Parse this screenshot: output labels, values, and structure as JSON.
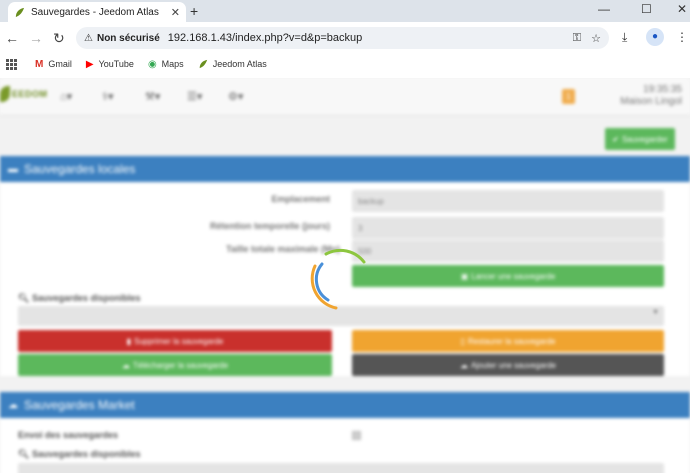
{
  "browser": {
    "tab_title": "Sauvegardes - Jeedom Atlas",
    "tab_close": "✕",
    "new_tab": "+",
    "window_controls": [
      "—",
      "☐",
      "✕"
    ],
    "security_label": "Non sécurisé",
    "url": "192.168.1.43/index.php?v=d&p=backup",
    "bookmarks": [
      {
        "label": "Gmail",
        "icon": "gmail-icon"
      },
      {
        "label": "YouTube",
        "icon": "youtube-icon"
      },
      {
        "label": "Maps",
        "icon": "maps-icon"
      },
      {
        "label": "Jeedom Atlas",
        "icon": "jeedom-icon"
      }
    ]
  },
  "app": {
    "logo_text": "EEDOM",
    "notification_count": "1",
    "time": "19:35:35",
    "location": "Maison Lingol",
    "save_button": "Sauvegarder"
  },
  "local_backups": {
    "title": "Sauvegardes locales",
    "location_label": "Emplacement",
    "location_value": "backup",
    "retention_label": "Rétention temporelle (jours)",
    "retention_value": "3",
    "max_size_label": "Taille totale maximale (Mo)",
    "max_size_value": "500",
    "launch_button": "Lancer une sauvegarde",
    "available_label": "Sauvegardes disponibles",
    "delete_button": "Supprimer la sauvegarde",
    "restore_button": "Restaurer la sauvegarde",
    "download_button": "Télécharger la sauvegarde",
    "add_button": "Ajouter une sauvegarde"
  },
  "market_backups": {
    "title": "Sauvegardes Market",
    "send_label": "Envoi des sauvegardes",
    "available_label": "Sauvegardes disponibles"
  },
  "colors": {
    "panel_header": "#3c80c0",
    "green": "#5cb85c",
    "red": "#c9302c",
    "orange": "#f0a430",
    "spinner_green": "#8dc63f",
    "spinner_blue": "#4a90d9",
    "spinner_orange": "#f0a430"
  }
}
